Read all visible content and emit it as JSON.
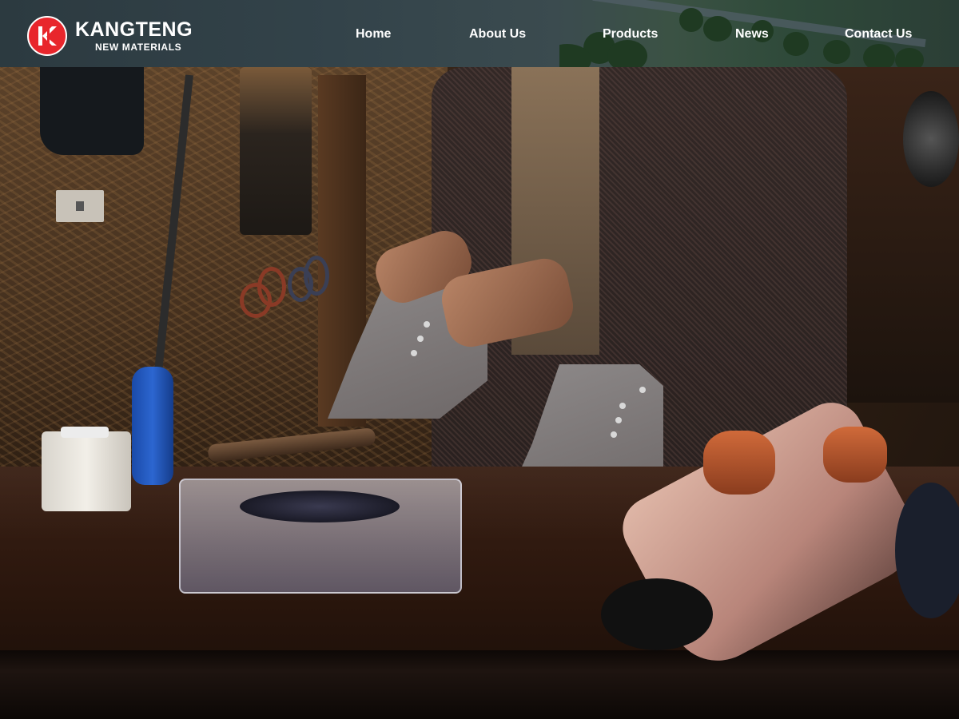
{
  "brand": {
    "name": "KANGTENG",
    "tagline": "NEW MATERIALS",
    "logo_mark": "K",
    "accent_color": "#e8262c"
  },
  "nav": {
    "items": [
      {
        "label": "Home"
      },
      {
        "label": "About Us"
      },
      {
        "label": "Products"
      },
      {
        "label": "News"
      },
      {
        "label": "Contact Us"
      }
    ]
  },
  "hero": {
    "image_subject": "craftsman shaping grey felt shoe uppers at a workbench"
  }
}
